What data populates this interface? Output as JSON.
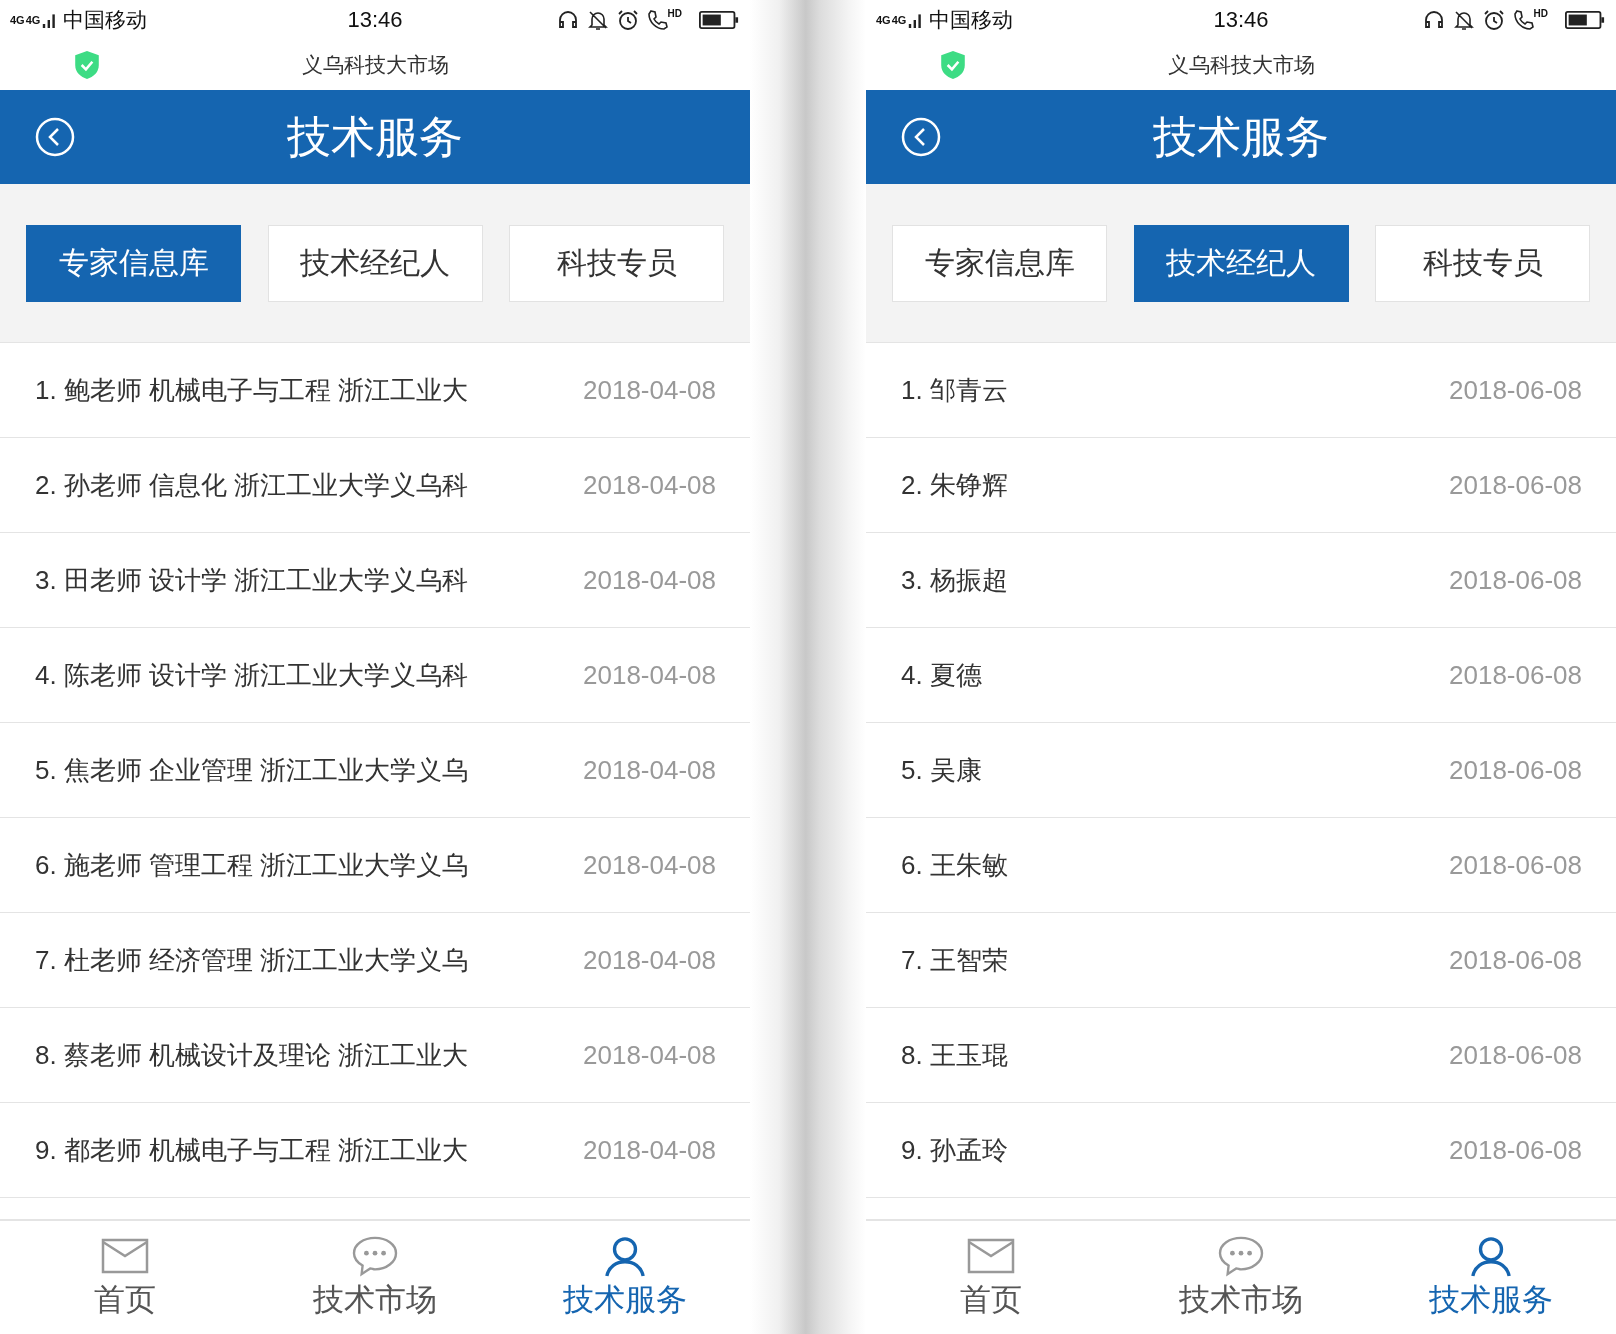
{
  "phones": [
    {
      "status": {
        "network": [
          "4G",
          "4G"
        ],
        "carrier": "中国移动",
        "time": "13:46",
        "hd": "HD"
      },
      "site": "义乌科技大市场",
      "title": "技术服务",
      "tabs": [
        {
          "label": "专家信息库",
          "selected": true
        },
        {
          "label": "技术经纪人",
          "selected": false
        },
        {
          "label": "科技专员",
          "selected": false
        }
      ],
      "rows": [
        {
          "text": "1. 鲍老师 机械电子与工程 浙江工业大",
          "date": "2018-04-08"
        },
        {
          "text": "2. 孙老师 信息化 浙江工业大学义乌科",
          "date": "2018-04-08"
        },
        {
          "text": "3. 田老师 设计学 浙江工业大学义乌科",
          "date": "2018-04-08"
        },
        {
          "text": "4. 陈老师 设计学 浙江工业大学义乌科",
          "date": "2018-04-08"
        },
        {
          "text": "5. 焦老师 企业管理 浙江工业大学义乌",
          "date": "2018-04-08"
        },
        {
          "text": "6. 施老师 管理工程 浙江工业大学义乌",
          "date": "2018-04-08"
        },
        {
          "text": "7. 杜老师 经济管理 浙江工业大学义乌",
          "date": "2018-04-08"
        },
        {
          "text": "8. 蔡老师 机械设计及理论 浙江工业大",
          "date": "2018-04-08"
        },
        {
          "text": "9. 都老师 机械电子与工程 浙江工业大",
          "date": "2018-04-08"
        }
      ],
      "nav": [
        {
          "label": "首页",
          "kind": "mail",
          "selected": false
        },
        {
          "label": "技术市场",
          "kind": "chat",
          "selected": false
        },
        {
          "label": "技术服务",
          "kind": "person",
          "selected": true
        }
      ]
    },
    {
      "status": {
        "network": [
          "4G",
          "4G"
        ],
        "carrier": "中国移动",
        "time": "13:46",
        "hd": "HD"
      },
      "site": "义乌科技大市场",
      "title": "技术服务",
      "tabs": [
        {
          "label": "专家信息库",
          "selected": false
        },
        {
          "label": "技术经纪人",
          "selected": true
        },
        {
          "label": "科技专员",
          "selected": false
        }
      ],
      "rows": [
        {
          "text": "1. 邹青云",
          "date": "2018-06-08"
        },
        {
          "text": "2. 朱铮辉",
          "date": "2018-06-08"
        },
        {
          "text": "3. 杨振超",
          "date": "2018-06-08"
        },
        {
          "text": "4. 夏德",
          "date": "2018-06-08"
        },
        {
          "text": "5. 吴康",
          "date": "2018-06-08"
        },
        {
          "text": "6. 王朱敏",
          "date": "2018-06-08"
        },
        {
          "text": "7. 王智荣",
          "date": "2018-06-08"
        },
        {
          "text": "8. 王玉琨",
          "date": "2018-06-08"
        },
        {
          "text": "9. 孙孟玲",
          "date": "2018-06-08"
        }
      ],
      "nav": [
        {
          "label": "首页",
          "kind": "mail",
          "selected": false
        },
        {
          "label": "技术市场",
          "kind": "chat",
          "selected": false
        },
        {
          "label": "技术服务",
          "kind": "person",
          "selected": true
        }
      ]
    }
  ]
}
